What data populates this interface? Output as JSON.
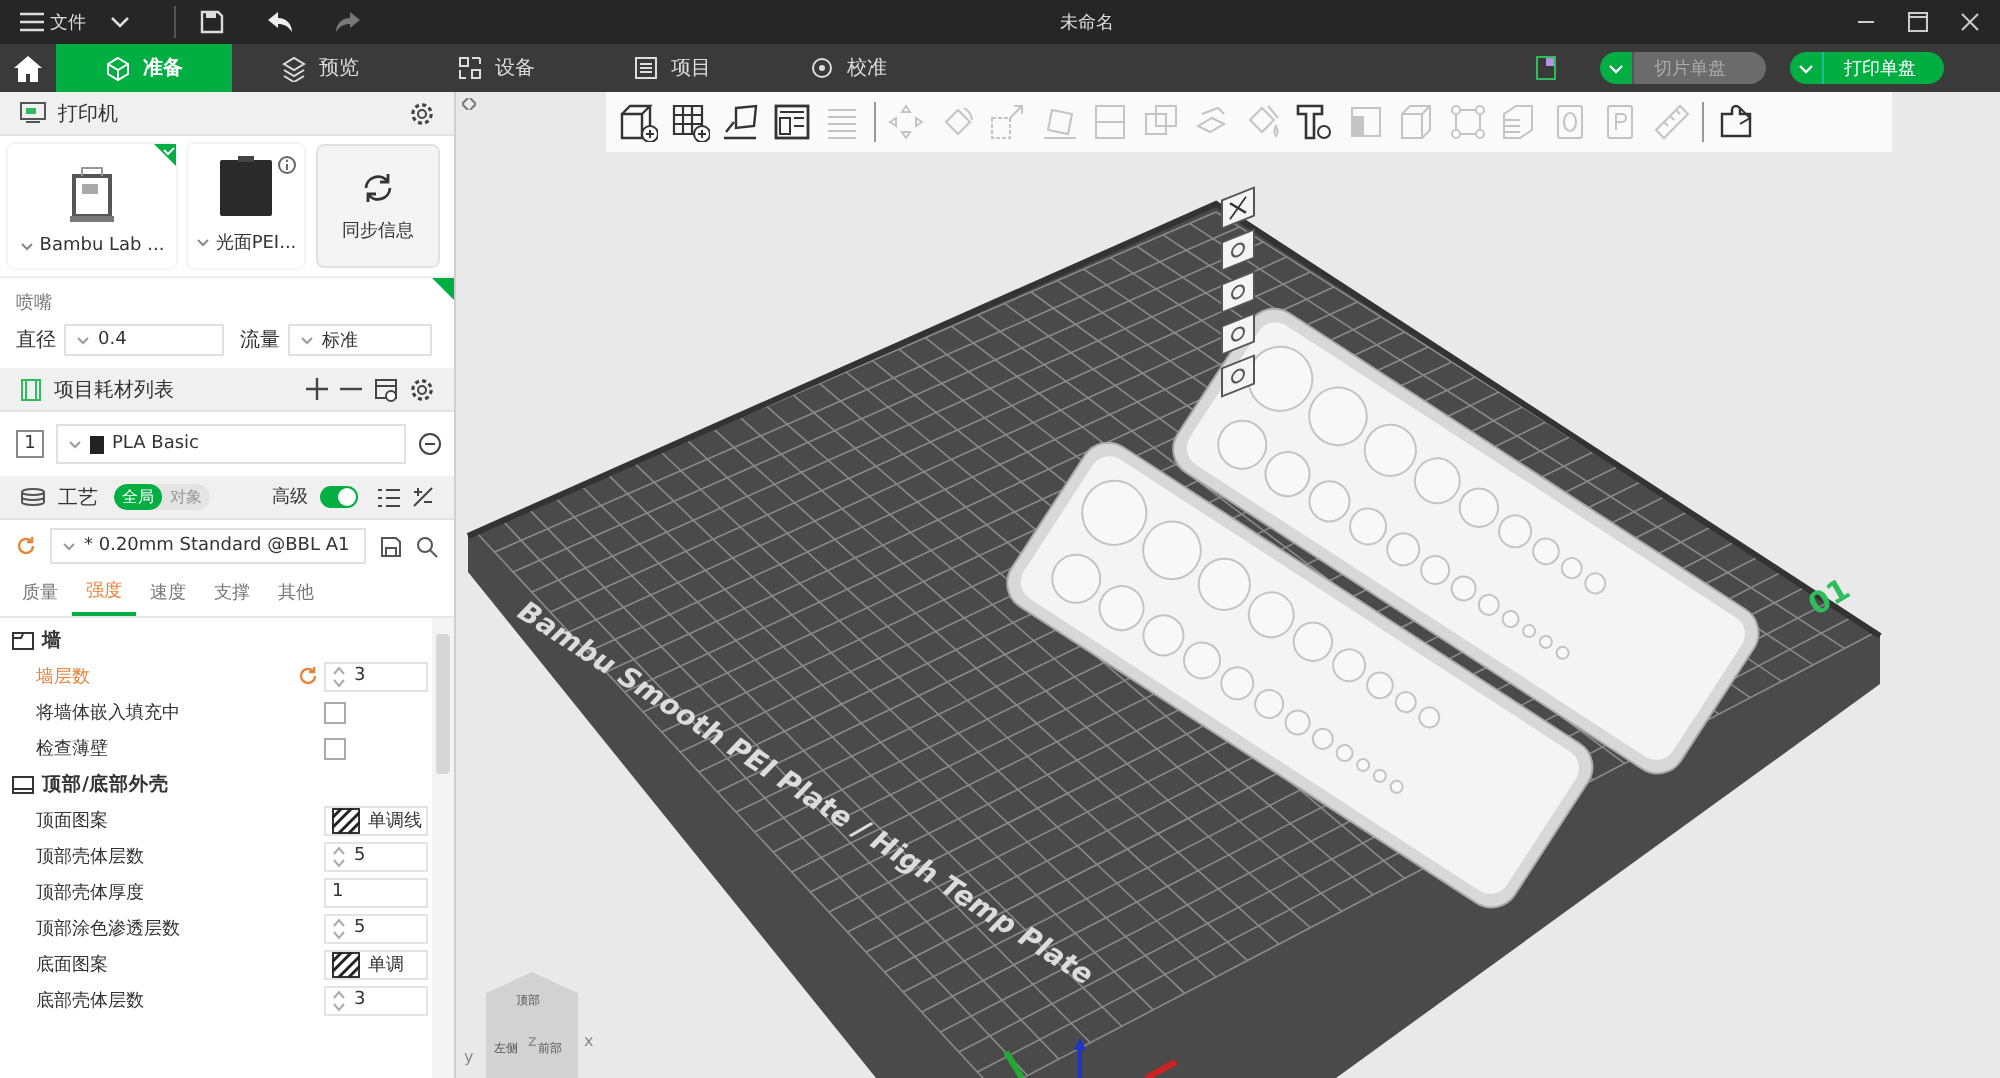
{
  "title_bar": {
    "menu_label": "文件",
    "title": "未命名"
  },
  "tabs": [
    {
      "label": "准备",
      "selected": true
    },
    {
      "label": "预览",
      "selected": false
    },
    {
      "label": "设备",
      "selected": false
    },
    {
      "label": "项目",
      "selected": false
    },
    {
      "label": "校准",
      "selected": false
    }
  ],
  "slice_button": {
    "label": "切片单盘",
    "disabled": true
  },
  "print_button": {
    "label": "打印单盘",
    "disabled": false
  },
  "printer_section": {
    "title": "打印机",
    "printer": {
      "name": "Bambu Lab ...",
      "selected": true
    },
    "plate": {
      "name": "光面PEI..."
    },
    "sync_button": "同步信息",
    "nozzle_label": "喷嘴",
    "diameter": {
      "label": "直径",
      "value": "0.4"
    },
    "flow": {
      "label": "流量",
      "value": "标准"
    }
  },
  "filament_section": {
    "title": "项目耗材列表",
    "filaments": [
      {
        "index": "1",
        "name": "PLA Basic",
        "color": "#222222"
      }
    ]
  },
  "process_section": {
    "title": "工艺",
    "scope_tabs": [
      {
        "label": "全局",
        "selected": true
      },
      {
        "label": "对象",
        "selected": false
      }
    ],
    "advanced": {
      "label": "高级",
      "on": true
    },
    "preset": "* 0.20mm Standard @BBL A1",
    "categories": [
      {
        "label": "质量",
        "selected": false
      },
      {
        "label": "强度",
        "selected": true
      },
      {
        "label": "速度",
        "selected": false
      },
      {
        "label": "支撑",
        "selected": false
      },
      {
        "label": "其他",
        "selected": false
      }
    ],
    "groups": [
      {
        "title": "墙",
        "settings": [
          {
            "label": "墙层数",
            "kind": "spin",
            "value": "3",
            "modified": true
          },
          {
            "label": "将墙体嵌入填充中",
            "kind": "checkbox",
            "checked": false,
            "modified": false
          },
          {
            "label": "检查薄壁",
            "kind": "checkbox",
            "checked": false,
            "modified": false
          }
        ]
      },
      {
        "title": "顶部/底部外壳",
        "settings": [
          {
            "label": "顶面图案",
            "kind": "pattern",
            "value": "单调线",
            "modified": false
          },
          {
            "label": "顶部壳体层数",
            "kind": "spin",
            "value": "5",
            "modified": false
          },
          {
            "label": "顶部壳体厚度",
            "kind": "text",
            "value": "1",
            "modified": false
          },
          {
            "label": "顶部涂色渗透层数",
            "kind": "spin",
            "value": "5",
            "modified": false
          },
          {
            "label": "底面图案",
            "kind": "pattern",
            "value": "单调",
            "modified": false
          },
          {
            "label": "底部壳体层数",
            "kind": "spin",
            "value": "3",
            "modified": false
          }
        ]
      }
    ]
  },
  "toolbar": {
    "tools": [
      {
        "disabled": false
      },
      {
        "disabled": false
      },
      {
        "disabled": false
      },
      {
        "disabled": false
      },
      {
        "disabled": true
      },
      {
        "disabled": true
      },
      {
        "disabled": true
      },
      {
        "disabled": true
      },
      {
        "disabled": true
      },
      {
        "disabled": true
      },
      {
        "disabled": true
      },
      {
        "disabled": true
      },
      {
        "disabled": true
      },
      {
        "disabled": false
      },
      {
        "disabled": true
      },
      {
        "disabled": true
      },
      {
        "disabled": true
      },
      {
        "disabled": true
      },
      {
        "disabled": true
      },
      {
        "disabled": true
      },
      {
        "disabled": true
      },
      {
        "disabled": false
      }
    ]
  },
  "viewport": {
    "plate_label": "Bambu Smooth PEI Plate / High Temp Plate",
    "plate_number": "01",
    "view_cube": [
      "顶部",
      "左侧",
      "前部"
    ],
    "axes": [
      "x",
      "y",
      "z"
    ]
  }
}
